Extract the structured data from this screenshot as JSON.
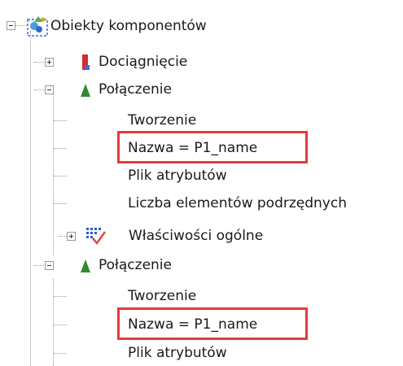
{
  "tree": {
    "root": {
      "label": "Obiekty komponentów",
      "icon": "components-objects-icon"
    },
    "items": [
      {
        "label": "Dociągnięcie",
        "icon": "tightening-icon",
        "expander": "plus"
      },
      {
        "label": "Połączenie",
        "icon": "connection-green-triangle-icon",
        "expander": "minus",
        "children": [
          "Tworzenie",
          "Nazwa = P1_name",
          "Plik atrybutów",
          "Liczba elementów podrzędnych"
        ],
        "subgroup": {
          "label": "Właściwości ogólne",
          "icon": "general-properties-icon",
          "expander": "plus"
        }
      },
      {
        "label": "Połączenie",
        "icon": "connection-green-triangle-icon",
        "expander": "minus",
        "children": [
          "Tworzenie",
          "Nazwa = P1_name",
          "Plik atrybutów"
        ]
      }
    ]
  },
  "colors": {
    "highlight": "#e23c3c",
    "connection_icon": "#2e8b2e",
    "tightening_icon": "#d62b2b"
  }
}
